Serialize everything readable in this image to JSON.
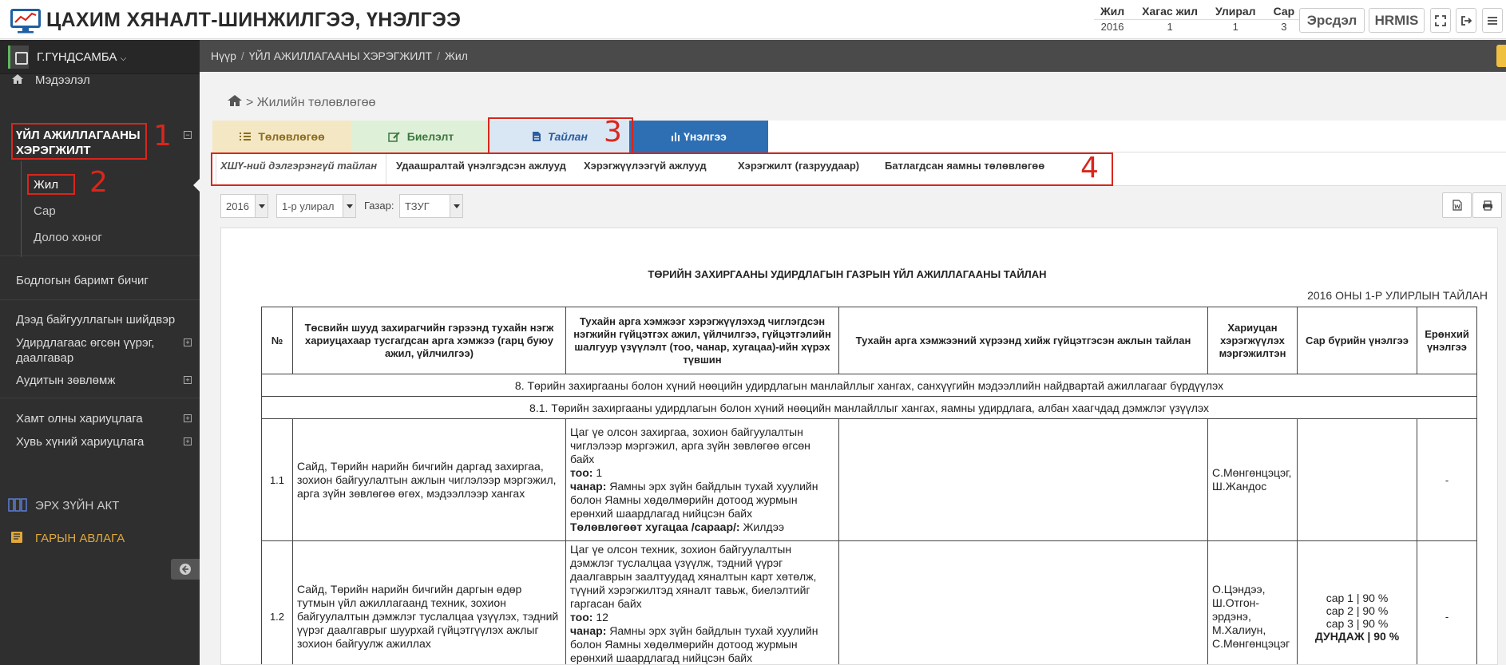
{
  "header": {
    "app_title": "ЦАХИМ ХЯНАЛТ-ШИНЖИЛГЭЭ, ҮНЭЛГЭЭ",
    "period_headers": [
      "Жил",
      "Хагас жил",
      "Улирал",
      "Сар"
    ],
    "period_values": [
      "2016",
      "1",
      "1",
      "3"
    ],
    "risk_button": "Эрсдэл",
    "hrmis_button": "HRMIS"
  },
  "sidebar": {
    "user_name": "Г.ГҮНДСАМБА",
    "info": "Мэдээлэл",
    "active_section": "ҮЙЛ АЖИЛЛАГААНЫ ХЭРЭГЖИЛТ",
    "sub_items": [
      "Жил",
      "Сар",
      "Долоо хоног"
    ],
    "items": [
      "Бодлогын баримт бичиг",
      "Дээд байгууллагын шийдвэр",
      "Удирдлагаас өгсөн үүрэг, даалгавар",
      "Аудитын зөвлөмж",
      "Хамт олны хариуцлага",
      "Хувь хүний хариуцлага"
    ],
    "law_acts": "ЭРХ ЗҮЙН АКТ",
    "manual": "ГАРЫН АВЛАГА",
    "annotations": [
      "1",
      "2"
    ]
  },
  "breadcrumb": [
    "Нүүр",
    "ҮЙЛ АЖИЛЛАГААНЫ ХЭРЭГЖИЛТ",
    "Жил"
  ],
  "page_heading": "> Жилийн төлөвлөгөө",
  "tabs": [
    {
      "label": "Төлөвлөгөө",
      "bg": "#f4e7c3",
      "color": "#8a6d1f"
    },
    {
      "label": "Биелэлт",
      "bg": "#dff0d8",
      "color": "#3c763d"
    },
    {
      "label": "Тайлан",
      "bg": "#d9e6f4",
      "color": "#2a5d9f"
    },
    {
      "label": "Үнэлгээ",
      "bg": "#2e6fb3",
      "color": "#ffffff"
    }
  ],
  "tab_annotation": "3",
  "subtabs": [
    "ХШҮ-ний дэлгэрэнгүй тайлан",
    "Удаашралтай үнэлгэдсэн ажлууд",
    "Хэрэгжүүлээгүй ажлууд",
    "Хэрэгжилт (газруудаар)",
    "Батлагдсан яамны төлөвлөгөө"
  ],
  "subtab_annotation": "4",
  "filters": {
    "year": "2016",
    "quarter": "1-р улирал",
    "place_label": "Газар:",
    "place": "ТЗУГ"
  },
  "report": {
    "title": "ТӨРИЙН ЗАХИРГААНЫ УДИРДЛАГЫН ГАЗРЫН ҮЙЛ АЖИЛЛАГААНЫ ТАЙЛАН",
    "subtitle": "2016 ОНЫ 1-Р УЛИРЛЫН ТАЙЛАН",
    "columns": [
      "№",
      "Төсвийн шууд захирагчийн гэрээнд тухайн нэгж хариуцахаар тусгагдсан арга хэмжээ (гарц буюу ажил, үйлчилгээ)",
      "Тухайн арга хэмжээг хэрэгжүүлэхэд чиглэгдсэн нэгжийн гүйцэтгэх ажил, үйлчилгээ, гүйцэтгэлийн шалгуур үзүүлэлт (тоо, чанар, хугацаа)-ийн хүрэх түвшин",
      "Тухайн арга хэмжээний хүрээнд хийж гүйцэтгэсэн ажлын тайлан",
      "Хариуцан хэрэгжүүлэх мэргэжилтэн",
      "Сар бүрийн үнэлгээ",
      "Ерөнхий үнэлгээ"
    ],
    "section_8": "8. Төрийн захиргааны болон хүний нөөцийн удирдлагын манлайллыг хангах, санхүүгийн мэдээллийн найдвартай ажиллагааг бүрдүүлэх",
    "section_81": "8.1. Төрийн захиргааны удирдлагын болон хүний нөөцийн манлайллыг хангах, яамны удирдлага, албан хаагчдад дэмжлэг үзүүлэх",
    "rows": [
      {
        "num": "1.1",
        "measure": "Сайд, Төрийн нарийн бичгийн даргад захиргаа, зохион байгуулалтын ажлын чиглэлээр мэргэжил, арга зүйн зөвлөгөө өгөх, мэдээллээр хангах",
        "work_text": "Цаг үе олсон захиргаа, зохион байгуулалтын чиглэлээр мэргэжил, арга зүйн зөвлөгөө өгсөн байх",
        "qty_label": "тоо:",
        "qty": "1",
        "quality_label": "чанар:",
        "quality": "Яамны эрх зүйн байдлын тухай хуулийн болон Яамны хөдөлмөрийн дотоод журмын ерөнхий шаардлагад нийцсэн байх",
        "time_label": "Төлөвлөгөөт хугацаа /сараар/:",
        "time": "Жилдээ",
        "report": "",
        "officer": "С.Мөнгөнцэцэг, Ш.Жандос",
        "monthly": [],
        "overall": "-"
      },
      {
        "num": "1.2",
        "measure": "Сайд, Төрийн нарийн бичгийн даргын өдөр тутмын үйл ажиллагаанд техник, зохион байгуулалтын дэмжлэг туслалцаа үзүүлэх, тэдний үүрэг даалгаврыг шуурхай гүйцэтгүүлэх ажлыг зохион байгуулж ажиллах",
        "work_text": "Цаг үе олсон техник, зохион байгуулалтын дэмжлэг туслалцаа үзүүлж, тэдний үүрэг даалгаврын заалтуудад хяналтын карт хөтөлж, түүний хэрэгжилтэд хяналт тавьж, биелэлтийг гаргасан байх",
        "qty_label": "тоо:",
        "qty": "12",
        "quality_label": "чанар:",
        "quality": "Яамны эрх зүйн байдлын тухай хуулийн болон Яамны хөдөлмөрийн дотоод журмын ерөнхий шаардлагад нийцсэн байх",
        "time_label": "",
        "time": "",
        "report": "",
        "officer": "О.Цэндээ, Ш.Отгон-эрдэнэ, М.Халиун, С.Мөнгөнцэцэг",
        "monthly": [
          "сар 1 | 90 %",
          "сар 2 | 90 %",
          "сар 3 | 90 %"
        ],
        "average": "ДУНДАЖ | 90 %",
        "overall": "-"
      }
    ]
  }
}
